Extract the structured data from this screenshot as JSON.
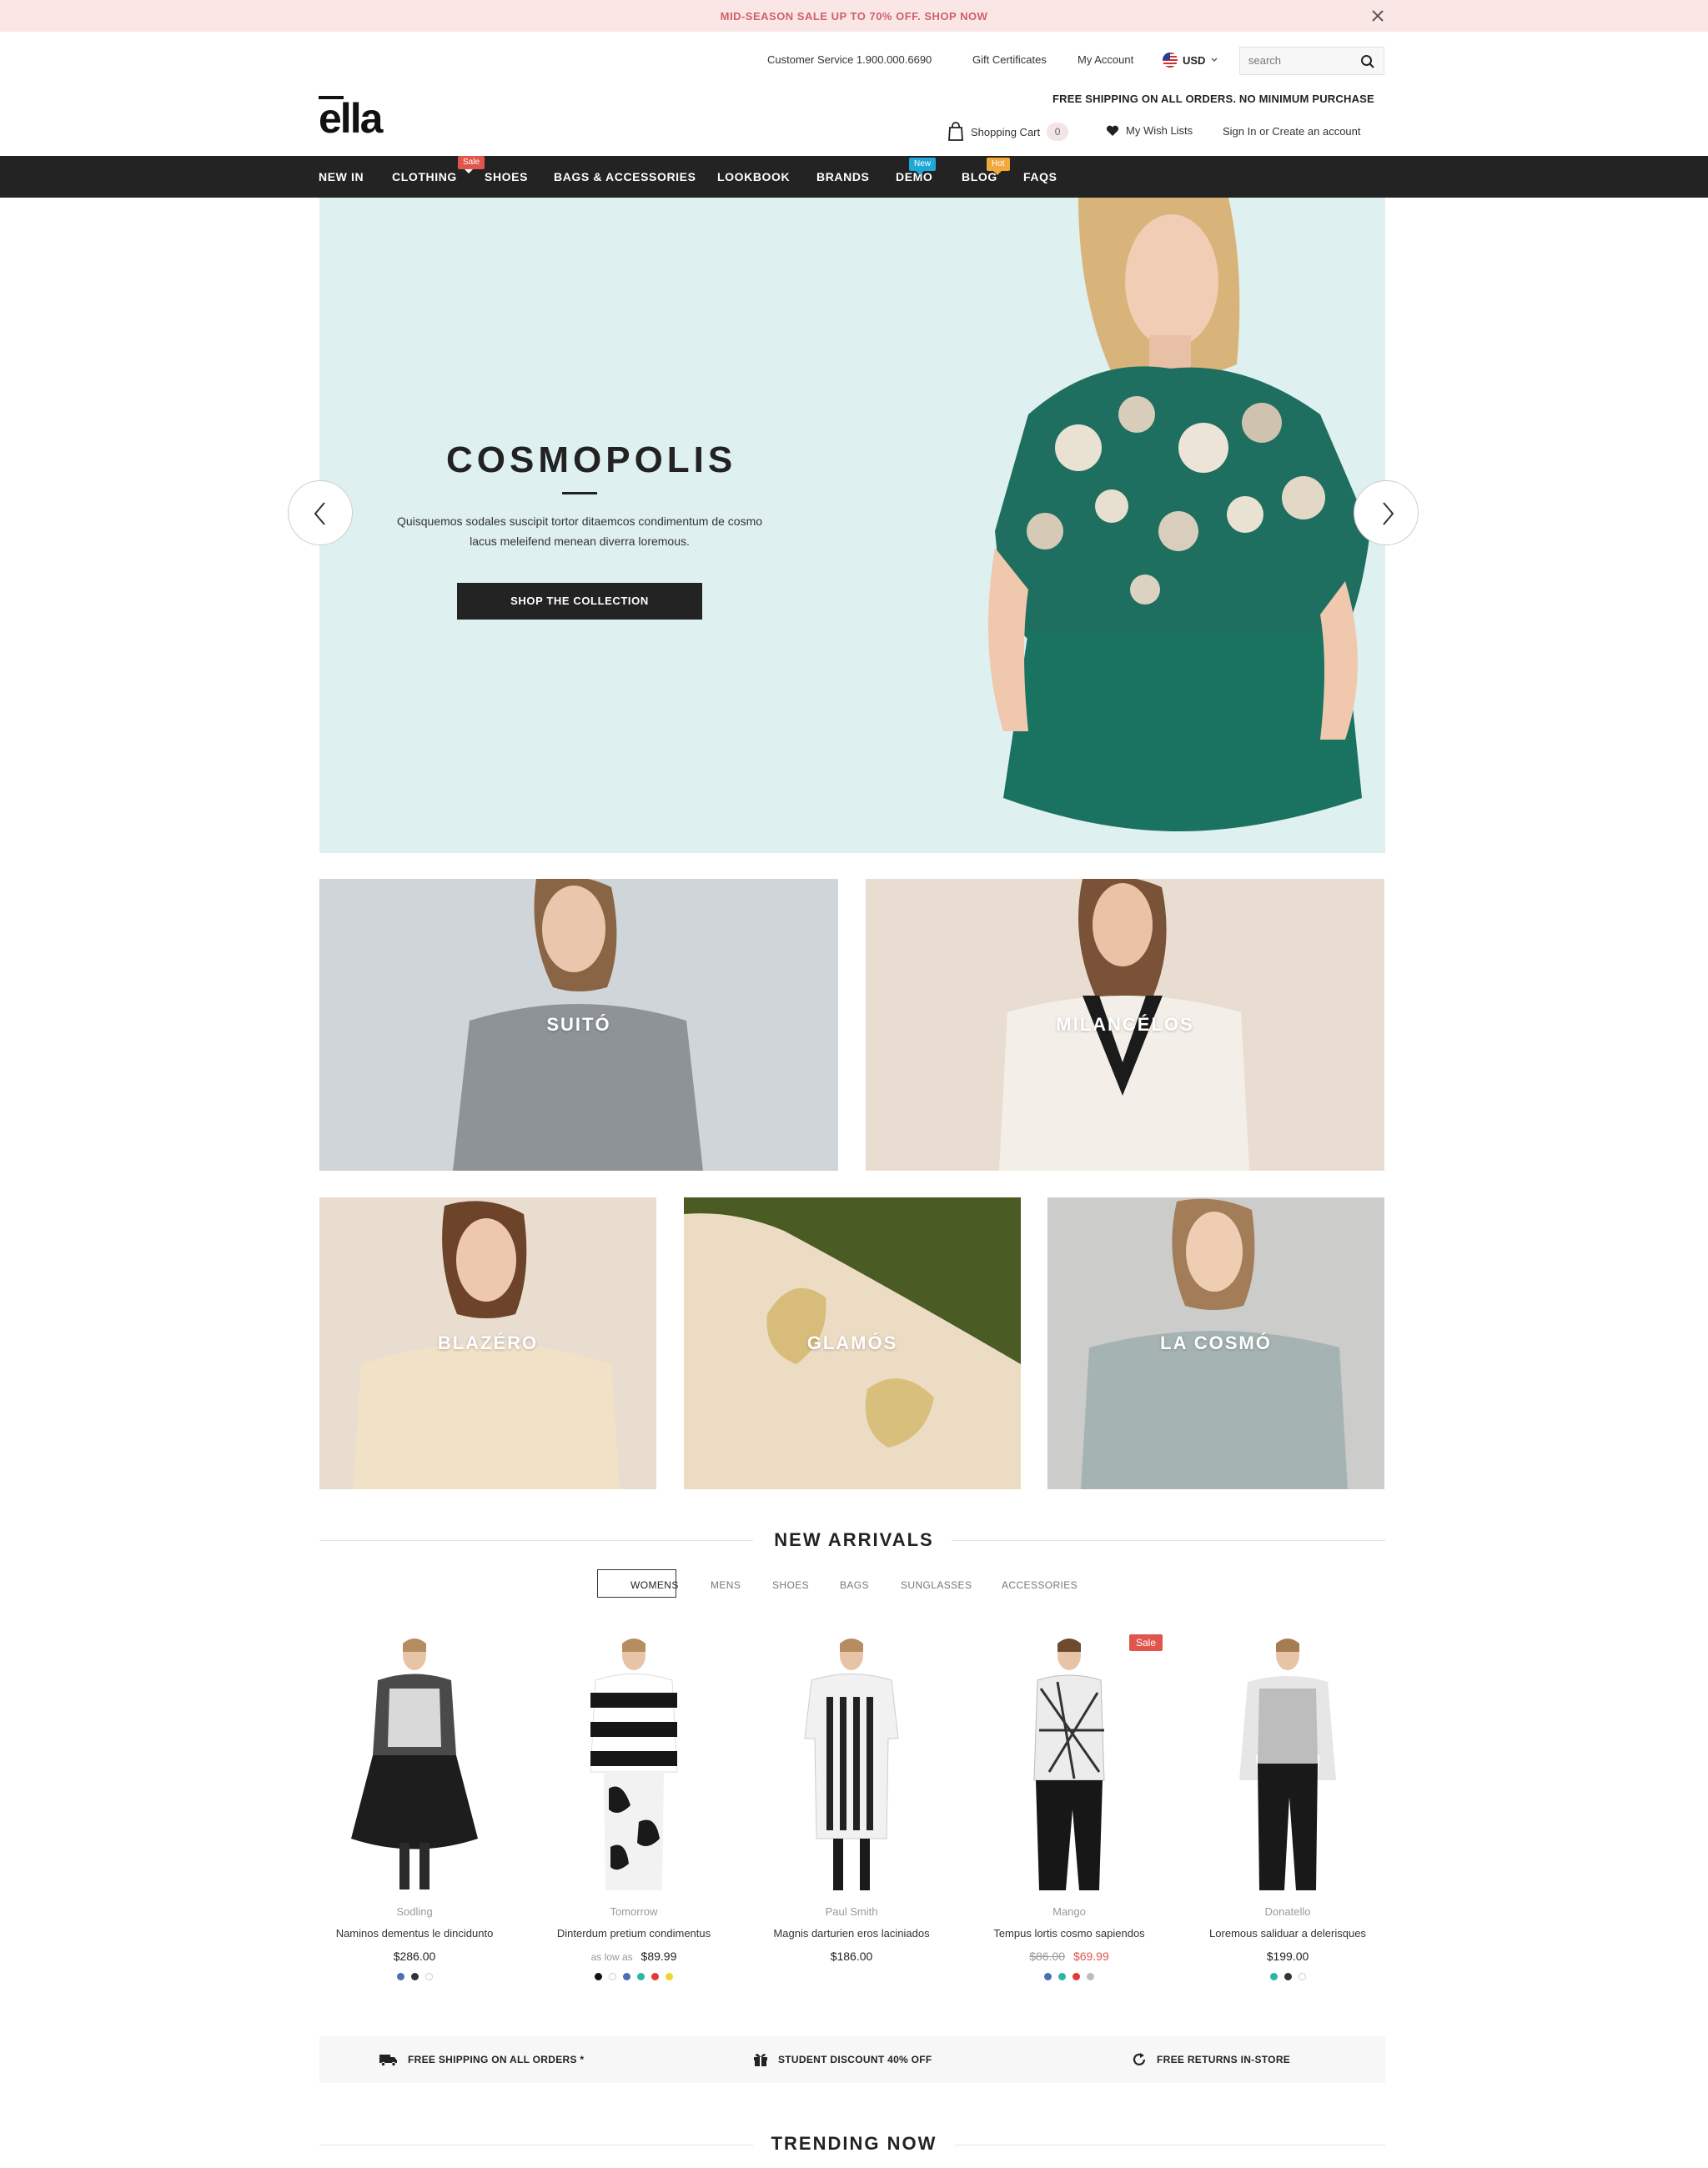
{
  "announcement": {
    "text": "MID-SEASON SALE UP TO 70% OFF. SHOP NOW"
  },
  "header": {
    "customer_service": "Customer Service 1.900.000.6690",
    "gift_certificates": "Gift Certificates",
    "my_account": "My Account",
    "currency": "USD",
    "search_placeholder": "search",
    "shipping_note": "FREE SHIPPING ON ALL ORDERS. NO MINIMUM PURCHASE",
    "logo": "ella",
    "cart_label": "Shopping Cart",
    "cart_count": "0",
    "wish_label": "My Wish Lists",
    "signin": "Sign In or Create an account"
  },
  "nav": {
    "items": [
      {
        "label": "NEW IN"
      },
      {
        "label": "CLOTHING"
      },
      {
        "label": "SHOES",
        "badge": "Sale"
      },
      {
        "label": "BAGS & ACCESSORIES"
      },
      {
        "label": "LOOKBOOK"
      },
      {
        "label": "BRANDS"
      },
      {
        "label": "DEMO",
        "badge": "New"
      },
      {
        "label": "BLOG",
        "badge": "Hot"
      },
      {
        "label": "FAQS"
      }
    ]
  },
  "hero": {
    "title": "COSMOPOLIS",
    "text": "Quisquemos sodales suscipit tortor ditaemcos condimentum de cosmo lacus meleifend menean diverra loremous.",
    "button": "SHOP THE COLLECTION"
  },
  "categories": [
    {
      "label": "SUITÓ"
    },
    {
      "label": "MILANCÉLOS"
    },
    {
      "label": "BLAZÉRO"
    },
    {
      "label": "GLAMÓS"
    },
    {
      "label": "LA COSMÓ"
    }
  ],
  "new_arrivals": {
    "title": "NEW ARRIVALS",
    "tabs": [
      "WOMENS",
      "MENS",
      "SHOES",
      "BAGS",
      "SUNGLASSES",
      "ACCESSORIES"
    ],
    "active_tab": "WOMENS",
    "products": [
      {
        "brand": "Sodling",
        "name": "Naminos dementus le dincidunto",
        "price": "$286.00",
        "swatches": [
          "#4a6fb5",
          "#333333",
          "#ffffff"
        ]
      },
      {
        "brand": "Tomorrow",
        "name": "Dinterdum pretium condimentus",
        "price_prefix": "as low as",
        "price": "$89.99",
        "swatches": [
          "#111111",
          "#ffffff",
          "#4a6fb5",
          "#2bb5a6",
          "#e03a3a",
          "#f2d22e"
        ]
      },
      {
        "brand": "Paul Smith",
        "name": "Magnis darturien eros laciniados",
        "price": "$186.00",
        "swatches": []
      },
      {
        "brand": "Mango",
        "name": "Tempus lortis cosmo sapiendos",
        "old_price": "$86.00",
        "sale_price": "$69.99",
        "badge": "Sale",
        "swatches": [
          "#4a6fb5",
          "#2bb5a6",
          "#e03a3a",
          "#bbbbbb"
        ]
      },
      {
        "brand": "Donatello",
        "name": "Loremous saliduar a delerisques",
        "price": "$199.00",
        "swatches": [
          "#2bb5a6",
          "#333333",
          "#ffffff"
        ]
      }
    ]
  },
  "services": [
    {
      "icon": "truck-icon",
      "label": "FREE SHIPPING ON ALL ORDERS *"
    },
    {
      "icon": "gift-icon",
      "label": "STUDENT DISCOUNT 40% OFF"
    },
    {
      "icon": "refresh-icon",
      "label": "FREE RETURNS IN-STORE"
    }
  ],
  "trending": {
    "title": "TRENDING NOW"
  },
  "colors": {
    "nav_bg": "#232323",
    "announce_bg": "#fbe6e6",
    "announce_text": "#d0606a",
    "sale": "#e0554c",
    "badge_new": "#1ea8d6",
    "badge_hot": "#f2a93b"
  }
}
